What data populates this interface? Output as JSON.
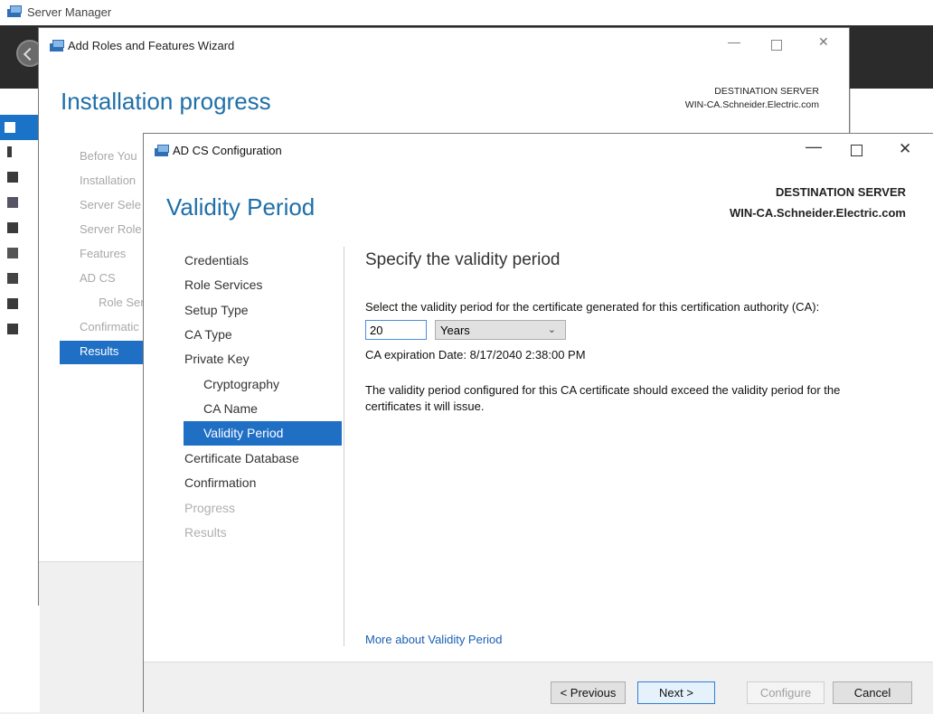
{
  "server_manager": {
    "title": "Server Manager"
  },
  "wizard": {
    "title": "Add Roles and Features Wizard",
    "heading": "Installation progress",
    "destination_label": "DESTINATION SERVER",
    "destination_server": "WIN-CA.Schneider.Electric.com",
    "nav": [
      {
        "label": "Before You"
      },
      {
        "label": "Installation"
      },
      {
        "label": "Server Sele"
      },
      {
        "label": "Server Role"
      },
      {
        "label": "Features"
      },
      {
        "label": "AD CS"
      },
      {
        "label": "Role Ser"
      },
      {
        "label": "Confirmatic"
      }
    ],
    "selected_nav": "Results"
  },
  "dialog": {
    "title": "AD CS Configuration",
    "heading": "Validity Period",
    "destination_label": "DESTINATION SERVER",
    "destination_server": "WIN-CA.Schneider.Electric.com",
    "nav": [
      {
        "label": "Credentials",
        "state": "normal"
      },
      {
        "label": "Role Services",
        "state": "normal"
      },
      {
        "label": "Setup Type",
        "state": "normal"
      },
      {
        "label": "CA Type",
        "state": "normal"
      },
      {
        "label": "Private Key",
        "state": "normal"
      },
      {
        "label": "Cryptography",
        "state": "sub"
      },
      {
        "label": "CA Name",
        "state": "sub"
      },
      {
        "label": "Validity Period",
        "state": "selected"
      },
      {
        "label": "Certificate Database",
        "state": "normal"
      },
      {
        "label": "Confirmation",
        "state": "normal"
      },
      {
        "label": "Progress",
        "state": "disabled"
      },
      {
        "label": "Results",
        "state": "disabled"
      }
    ],
    "content": {
      "subheading": "Specify the validity period",
      "instruction": "Select the validity period for the certificate generated for this certification authority (CA):",
      "period_value": "20",
      "period_unit": "Years",
      "expiration": "CA expiration Date: 8/17/2040 2:38:00 PM",
      "note": "The validity period configured for this CA certificate should exceed the validity period for the certificates it will issue.",
      "more_link": "More about Validity Period"
    },
    "buttons": {
      "previous": "< Previous",
      "next": "Next >",
      "configure": "Configure",
      "cancel": "Cancel"
    }
  },
  "colors": {
    "accent": "#1f6fc5",
    "heading": "#1f6fa8",
    "link": "#1a5fb4"
  }
}
